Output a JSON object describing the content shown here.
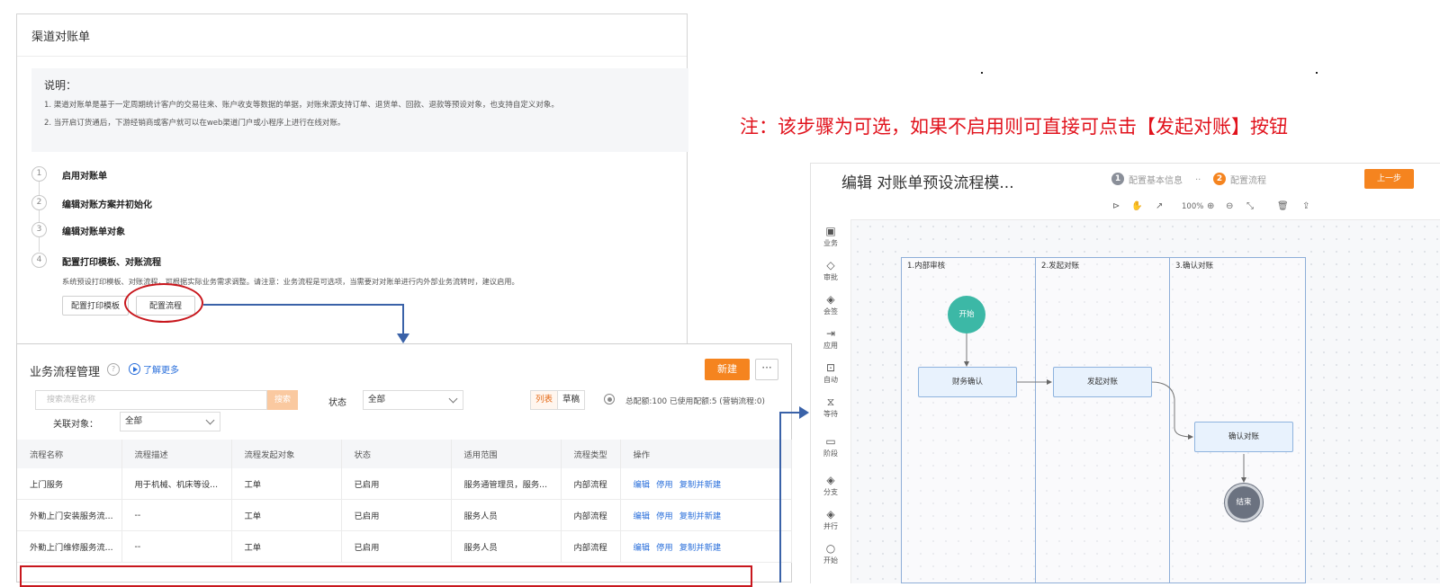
{
  "channel_statement": {
    "title": "渠道对账单",
    "explanation_title": "说明：",
    "explanation_lines": [
      "1. 渠道对账单是基于一定周期统计客户的交易往来、账户收支等数据的单据，对账来源支持订单、退货单、回款、退款等预设对象，也支持自定义对象。",
      "2. 当开启订货通后，下游经销商或客户就可以在web渠道门户或小程序上进行在线对账。"
    ],
    "steps": [
      {
        "num": "1",
        "label": "启用对账单"
      },
      {
        "num": "2",
        "label": "编辑对账方案并初始化"
      },
      {
        "num": "3",
        "label": "编辑对账单对象"
      },
      {
        "num": "4",
        "label": "配置打印模板、对账流程"
      }
    ],
    "step4_desc": "系统预设打印模板、对账流程，可根据实际业务需求调整。请注意：业务流程是可选项，当需要对对账单进行内外部业务流转时，建议启用。",
    "buttons": {
      "print_template": "配置打印模板",
      "config_flow": "配置流程"
    }
  },
  "process_mgmt": {
    "title": "业务流程管理",
    "help": "?",
    "learn_more": "了解更多",
    "new_btn": "新建",
    "more_btn": "···",
    "search_placeholder": "搜索流程名称",
    "search_btn": "搜索",
    "status_label": "状态",
    "status_value": "全部",
    "view_list": "列表",
    "view_draft": "草稿",
    "quota": "总配额:100 已使用配额:5 (营销流程:0)",
    "related_label": "关联对象：",
    "related_value": "全部",
    "columns": [
      "流程名称",
      "流程描述",
      "流程发起对象",
      "状态",
      "适用范围",
      "流程类型",
      "操作"
    ],
    "rows": [
      {
        "name": "上门服务",
        "desc": "用于机械、机床等设...",
        "obj": "工单",
        "status": "已启用",
        "scope": "服务通管理员，服务...",
        "type": "内部流程"
      },
      {
        "name": "外勤上门安装服务流...",
        "desc": "--",
        "obj": "工单",
        "status": "已启用",
        "scope": "服务人员",
        "type": "内部流程"
      },
      {
        "name": "外勤上门维修服务流...",
        "desc": "--",
        "obj": "工单",
        "status": "已启用",
        "scope": "服务人员",
        "type": "内部流程"
      }
    ],
    "ops": [
      "编辑",
      "停用",
      "复制并新建"
    ]
  },
  "note": "注：该步骤为可选，如果不启用则可直接可点击【发起对账】按钮",
  "flow_editor": {
    "title": "编辑 对账单预设流程模...",
    "step1_num": "1",
    "step1_label": "配置基本信息",
    "sep": "..",
    "step2_num": "2",
    "step2_label": "配置流程",
    "prev_btn": "上一步",
    "zoom": "100%",
    "tools": [
      "业务",
      "审批",
      "会签",
      "应用",
      "自动",
      "等待",
      "阶段",
      "分支",
      "并行",
      "开始"
    ],
    "lanes": [
      "1.内部审核",
      "2.发起对账",
      "3.确认对账"
    ],
    "start_node": "开始",
    "end_node": "结束",
    "nodes": [
      "财务确认",
      "发起对账",
      "确认对账"
    ],
    "accent": "#f5841f",
    "start_color": "#3cb8a6"
  }
}
